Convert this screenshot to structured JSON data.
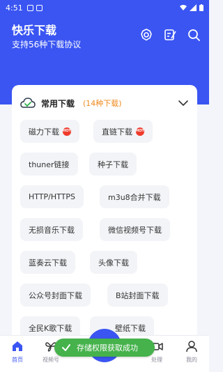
{
  "status_bar": {
    "time": "4:51"
  },
  "header": {
    "title": "快乐下载",
    "subtitle": "支持56种下载协议"
  },
  "card": {
    "title": "常用下载",
    "count": "(14种下载)",
    "chips": [
      {
        "label": "磁力下载",
        "hot": true
      },
      {
        "label": "直链下载",
        "hot": true
      },
      {
        "label": "thuner链接"
      },
      {
        "label": "种子下载"
      },
      {
        "label": "HTTP/HTTPS"
      },
      {
        "label": "m3u8合并下载"
      },
      {
        "label": "无损音乐下载"
      },
      {
        "label": "微信视频号下载"
      },
      {
        "label": "蓝奏云下载"
      },
      {
        "label": "头像下载"
      },
      {
        "label": "公众号封面下载"
      },
      {
        "label": "B站封面下载"
      },
      {
        "label": "全民K歌下载"
      },
      {
        "label": "壁纸下载"
      }
    ]
  },
  "tabs": [
    {
      "label": "首页"
    },
    {
      "label": "视频号"
    },
    {
      "label": "处理"
    },
    {
      "label": "我的"
    }
  ],
  "toast": {
    "message": "存储权限获取成功"
  },
  "colors": {
    "primary": "#3a55f2",
    "accent": "#f08a1c",
    "hot": "#ef3b2c",
    "toast": "#45b24b"
  }
}
